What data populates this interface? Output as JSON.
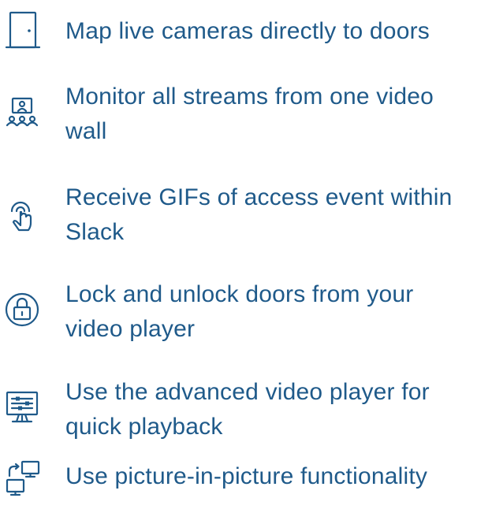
{
  "colors": {
    "accent": "#1f5a8a",
    "background": "#ffffff"
  },
  "features": [
    {
      "icon": "door-icon",
      "text": "Map live cameras directly to doors"
    },
    {
      "icon": "video-wall-icon",
      "text": "Monitor all streams from one video wall"
    },
    {
      "icon": "touch-icon",
      "text": "Receive GIFs of access event within Slack"
    },
    {
      "icon": "lock-icon",
      "text": "Lock and unlock doors from your video player"
    },
    {
      "icon": "video-player-icon",
      "text": "Use the advanced video player for quick playback"
    },
    {
      "icon": "picture-in-picture-icon",
      "text": "Use picture-in-picture functionality"
    }
  ]
}
